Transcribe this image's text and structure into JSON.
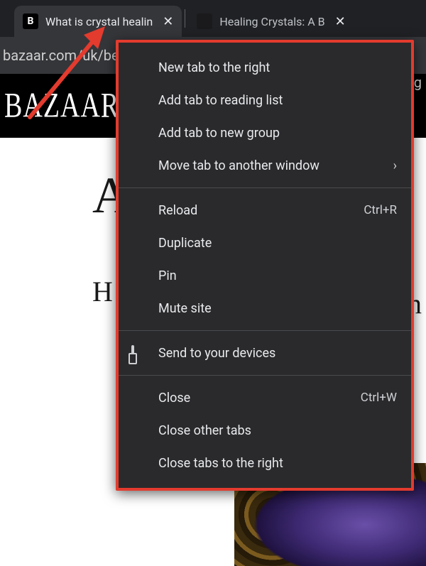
{
  "tabs": [
    {
      "favicon_letter": "B",
      "title": "What is crystal healin"
    },
    {
      "favicon_letter": "",
      "title": "Healing Crystals: A B"
    }
  ],
  "addressbar": {
    "url_fragment": "bazaar.com/uk/be"
  },
  "page": {
    "brand": "BAZAAR",
    "h1_fragment": "A",
    "sub_fragment_left": "H",
    "sub_fragment_right": "n",
    "url_right_fragment": "g"
  },
  "context_menu": {
    "groups": [
      [
        {
          "label": "New tab to the right"
        },
        {
          "label": "Add tab to reading list"
        },
        {
          "label": "Add tab to new group"
        },
        {
          "label": "Move tab to another window",
          "submenu": true
        }
      ],
      [
        {
          "label": "Reload",
          "accel": "Ctrl+R"
        },
        {
          "label": "Duplicate"
        },
        {
          "label": "Pin"
        },
        {
          "label": "Mute site"
        }
      ],
      [
        {
          "label": "Send to your devices",
          "icon": "devices"
        }
      ],
      [
        {
          "label": "Close",
          "accel": "Ctrl+W"
        },
        {
          "label": "Close other tabs"
        },
        {
          "label": "Close tabs to the right"
        }
      ]
    ]
  },
  "annotation": {
    "arrow_color": "#e33b2e"
  }
}
